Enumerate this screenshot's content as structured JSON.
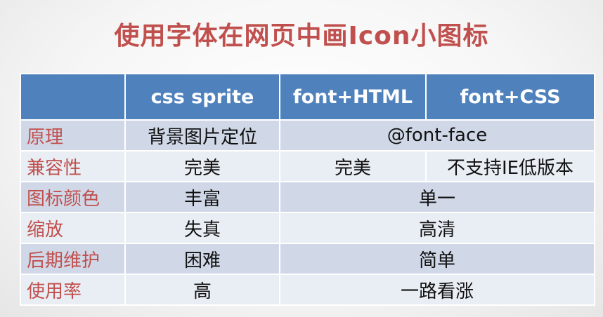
{
  "title": "使用字体在网页中画Icon小图标",
  "header": [
    "",
    "css sprite",
    "font+HTML",
    "font+CSS"
  ],
  "rows": [
    {
      "label": "原理",
      "sprite": "背景图片定位",
      "font": "@font-face"
    },
    {
      "label": "兼容性",
      "sprite": "完美",
      "font_html": "完美",
      "font_css": "不支持IE低版本"
    },
    {
      "label": "图标颜色",
      "sprite": "丰富",
      "font": "单一"
    },
    {
      "label": "缩放",
      "sprite": "失真",
      "font": "高清"
    },
    {
      "label": "后期维护",
      "sprite": "困难",
      "font": "简单"
    },
    {
      "label": "使用率",
      "sprite": "高",
      "font": "一路看涨"
    }
  ]
}
